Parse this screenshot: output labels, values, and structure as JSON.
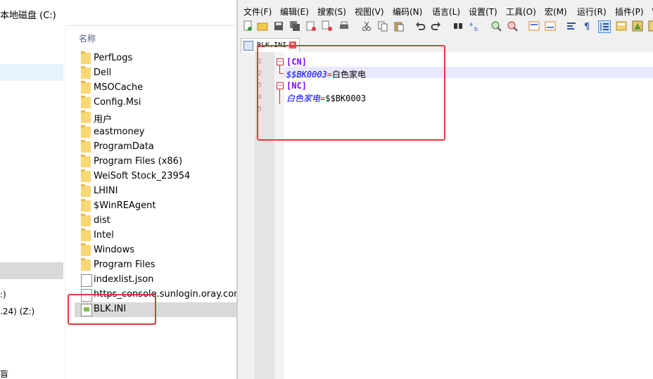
{
  "explorer": {
    "address": "本地磁盘 (C:)",
    "column_header": "名称",
    "nav_labels": [
      ":)",
      ".24) (Z:)",
      "盲"
    ],
    "files": [
      {
        "name": "PerfLogs",
        "icon": "folder-icon"
      },
      {
        "name": "Dell",
        "icon": "folder-icon"
      },
      {
        "name": "MSOCache",
        "icon": "folder-icon"
      },
      {
        "name": "Config.Msi",
        "icon": "folder-icon"
      },
      {
        "name": "用户",
        "icon": "folder-icon"
      },
      {
        "name": "eastmoney",
        "icon": "folder-icon"
      },
      {
        "name": "ProgramData",
        "icon": "folder-icon"
      },
      {
        "name": "Program Files (x86)",
        "icon": "folder-icon"
      },
      {
        "name": "WeiSoft Stock_23954",
        "icon": "folder-icon"
      },
      {
        "name": "LHINI",
        "icon": "folder-icon"
      },
      {
        "name": "$WinREAgent",
        "icon": "folder-icon"
      },
      {
        "name": "dist",
        "icon": "folder-icon"
      },
      {
        "name": "Intel",
        "icon": "folder-icon"
      },
      {
        "name": "Windows",
        "icon": "folder-icon"
      },
      {
        "name": "Program Files",
        "icon": "folder-icon"
      },
      {
        "name": "indexlist.json",
        "icon": "document-icon"
      },
      {
        "name": "https_console.sunlogin.oray.com.log",
        "icon": "document-icon"
      },
      {
        "name": "BLK.INI",
        "icon": "ini-file-icon"
      }
    ]
  },
  "notepad": {
    "menu": [
      "文件(F)",
      "编辑(E)",
      "搜索(S)",
      "视图(V)",
      "编码(N)",
      "语言(L)",
      "设置(T)",
      "工具(O)",
      "宏(M)",
      "运行(R)",
      "插件(P)",
      "窗"
    ],
    "tab_title": "BLK.INI",
    "line_numbers": [
      "1",
      "2",
      "3",
      "4",
      "5"
    ],
    "lines": [
      {
        "section": "[CN]"
      },
      {
        "key": "$$BK0003",
        "eq": "=",
        "value": "白色家电"
      },
      {
        "section": "[NC]"
      },
      {
        "key": "白色家电",
        "eq": "=",
        "value": "$$BK0003"
      },
      {}
    ],
    "colors": {
      "section": "#8000ff",
      "key": "#0000ff",
      "equals": "#ff0000",
      "highlight_box": "#e23a3a"
    }
  }
}
